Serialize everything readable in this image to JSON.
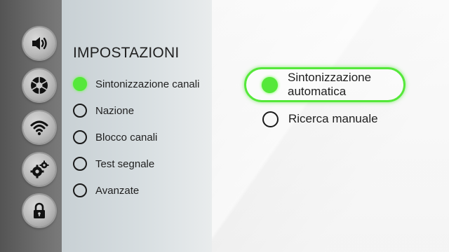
{
  "colors": {
    "accent": "#55e83a",
    "text": "#1f1f1f",
    "rail": "#5c5c5c"
  },
  "side_icons": [
    {
      "name": "speaker-icon"
    },
    {
      "name": "aperture-icon"
    },
    {
      "name": "wifi-icon"
    },
    {
      "name": "gears-icon"
    },
    {
      "name": "lock-icon"
    }
  ],
  "menu": {
    "title": "IMPOSTAZIONI",
    "items": [
      {
        "label": "Sintonizzazione canali",
        "selected": true
      },
      {
        "label": "Nazione",
        "selected": false
      },
      {
        "label": "Blocco canali",
        "selected": false
      },
      {
        "label": "Test segnale",
        "selected": false
      },
      {
        "label": "Avanzate",
        "selected": false
      }
    ]
  },
  "options": [
    {
      "line1": "Sintonizzazione",
      "line2": "automatica",
      "selected": true
    },
    {
      "label": "Ricerca manuale",
      "selected": false
    }
  ]
}
